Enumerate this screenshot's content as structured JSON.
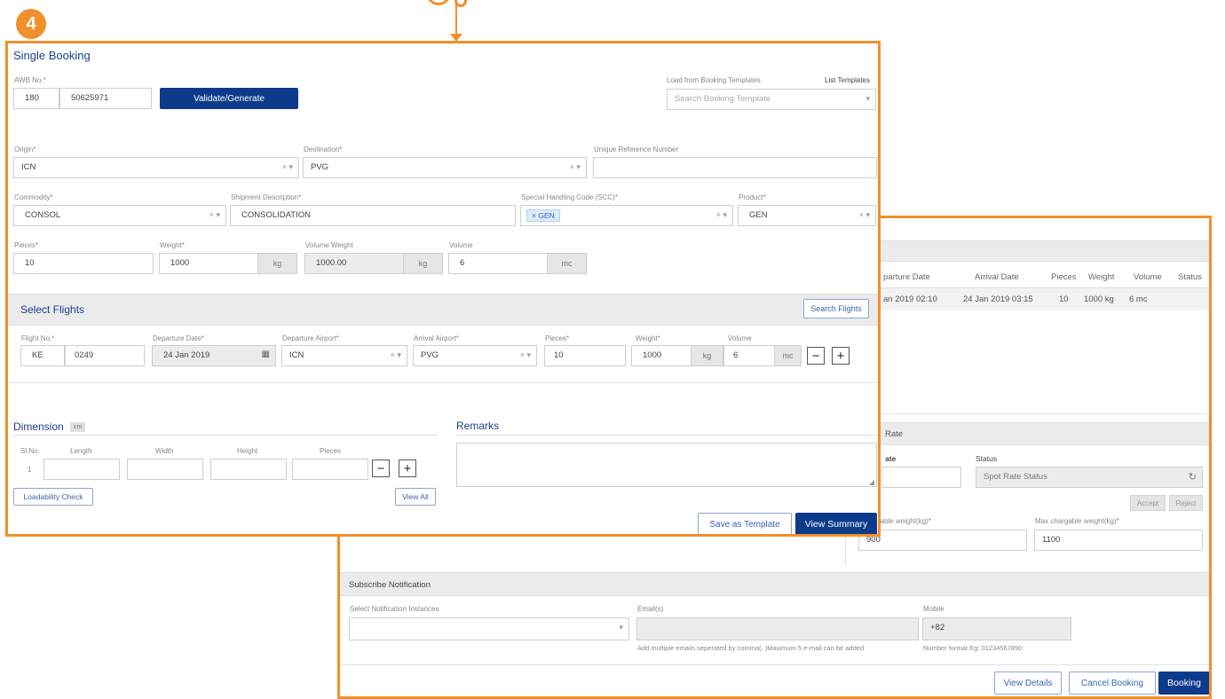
{
  "callout": {
    "number": "4"
  },
  "single": {
    "title": "Single Booking",
    "awb": {
      "label": "AWB No.*",
      "prefix": "180",
      "number": "50625971",
      "validate_label": "Validate/Generate"
    },
    "templates": {
      "label": "Load from Booking Templates",
      "link": "List Templates",
      "placeholder": "Search Booking Template"
    },
    "origin": {
      "label": "Origin*",
      "value": "ICN"
    },
    "destination": {
      "label": "Destination*",
      "value": "PVG"
    },
    "urn": {
      "label": "Unique Reference Number",
      "value": ""
    },
    "commodity": {
      "label": "Commodity*",
      "value": "CONSOL"
    },
    "shipment": {
      "label": "Shipment Description*",
      "value": "CONSOLIDATION"
    },
    "shc": {
      "label": "Special Handling Code (SCC)*",
      "tag": "GEN"
    },
    "product": {
      "label": "Product*",
      "value": "GEN"
    },
    "pieces": {
      "label": "Pieces*",
      "value": "10"
    },
    "weight": {
      "label": "Weight*",
      "value": "1000",
      "unit": "kg"
    },
    "volwt": {
      "label": "Volume Weight",
      "value": "1000.00",
      "unit": "kg"
    },
    "volume": {
      "label": "Volume",
      "value": "6",
      "unit": "mc"
    },
    "flights": {
      "title": "Select Flights",
      "search_label": "Search Flights",
      "flight_no_label": "Flight No.*",
      "carrier": "KE",
      "flight_no": "0249",
      "dep_date_label": "Departure Date*",
      "dep_date": "24 Jan 2019",
      "dep_airport_label": "Departure Airport*",
      "dep_airport": "ICN",
      "arr_airport_label": "Arrival Airport*",
      "arr_airport": "PVG",
      "pieces_label": "Pieces*",
      "pieces": "10",
      "weight_label": "Weight*",
      "weight": "1000",
      "weight_unit": "kg",
      "volume_label": "Volume",
      "volume": "6",
      "volume_unit": "mc"
    },
    "dimension": {
      "title": "Dimension",
      "badge": "cm",
      "cols": {
        "sno": "Sl.No.",
        "length": "Length",
        "width": "Width",
        "height": "Height",
        "pieces": "Pieces"
      },
      "row_no": "1",
      "loadability": "Loadability Check",
      "view_all": "View All"
    },
    "remarks": {
      "title": "Remarks"
    },
    "save_template": "Save as Template",
    "view_summary": "View Summary"
  },
  "summary": {
    "table": {
      "headers": [
        "parture Date",
        "Arrival Date",
        "Pieces",
        "Weight",
        "Volume",
        "Status"
      ],
      "row": [
        "an 2019 02:10",
        "24 Jan 2019 03:15",
        "10",
        "1000 kg",
        "6 mc",
        ""
      ]
    },
    "rate": {
      "title": "Rate",
      "col_label": "ate",
      "status_label": "Status",
      "status_placeholder": "Spot Rate Status",
      "accept": "Accept",
      "reject": "Reject"
    },
    "chargeable": {
      "min_label": "argable weight(kg)*",
      "min_value": "900",
      "max_label": "Max chargable weight(kg)*",
      "max_value": "1100"
    },
    "notify": {
      "title": "Subscribe Notification",
      "instances_label": "Select Notification Instances",
      "emails_label": "Email(s)",
      "mobile_label": "Mobile",
      "mobile_value": "+82",
      "emails_hint": "Add multiple emails seperated by comma(, )Maximum 5 e-mail can be added",
      "mobile_hint": "Number format Eg: 01234567890"
    },
    "buttons": {
      "view_details": "View Details",
      "cancel_booking": "Cancel Booking",
      "booking": "Booking"
    }
  },
  "colors": {
    "callout": "#f0902a",
    "primary": "#0d3b8c",
    "link": "#3a64b0"
  }
}
